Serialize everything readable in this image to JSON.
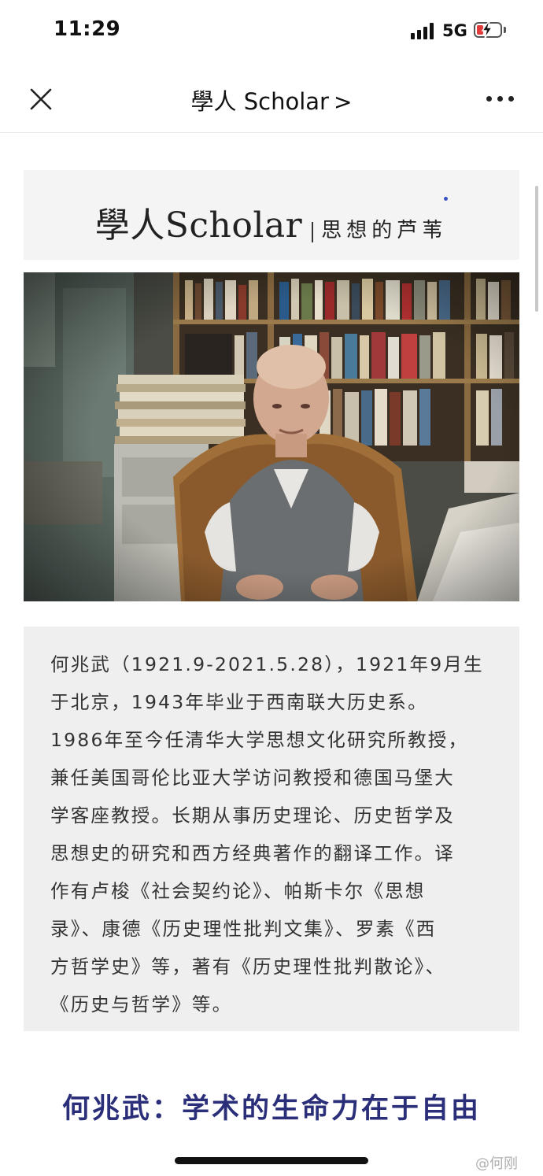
{
  "status_bar": {
    "time": "11:29",
    "network": "5G",
    "battery_color": "#e23b3b"
  },
  "nav": {
    "title": "學人 Scholar",
    "chevron": ">",
    "close_icon": "close-icon",
    "more_icon": "more-icon"
  },
  "banner": {
    "main": "學人Scholar",
    "sub": "思想的芦苇"
  },
  "bio": {
    "lines": [
      "何兆武（1921.9-2021.5.28），1921年9月生",
      "于北京，1943年毕业于西南联大历史系。",
      "1986年至今任清华大学思想文化研究所教授，",
      "兼任美国哥伦比亚大学访问教授和德国马堡大",
      "学客座教授。长期从事历史理论、历史哲学及",
      "思想史的研究和西方经典著作的翻译工作。译",
      "作有卢梭《社会契约论》、帕斯卡尔《思想",
      "录》、康德《历史理性批判文集》、罗素《西",
      "方哲学史》等，著有《历史理性批判散论》、",
      "《历史与哲学》等。"
    ]
  },
  "article": {
    "title": "何兆武：学术的生命力在于自由"
  },
  "watermark": "@何刚",
  "colors": {
    "title": "#2b2f7a",
    "bio_bg": "#efefef",
    "banner_bg": "#f4f4f4",
    "accent_dot": "#3a53c5"
  }
}
